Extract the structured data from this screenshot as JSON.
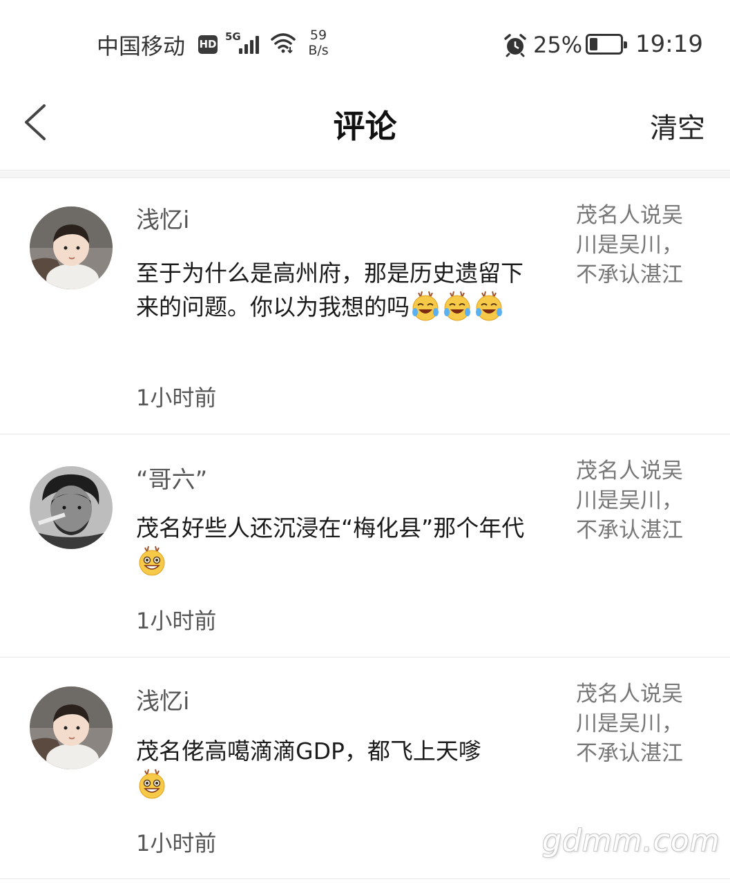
{
  "status_bar": {
    "carrier": "中国移动",
    "hd_badge": "HD",
    "network": "5G",
    "speed_value": "59",
    "speed_unit": "B/s",
    "battery_percent": "25%",
    "battery_level": 0.25,
    "time": "19:19",
    "icons": [
      "signal-icon",
      "wifi-icon",
      "alarm-icon",
      "battery-icon"
    ]
  },
  "header": {
    "title": "评论",
    "clear_label": "清空",
    "back_icon": "chevron-left-icon"
  },
  "comments": [
    {
      "username": "浅忆i",
      "text": "至于为什么是高州府，那是历史遗留下来的问题。你以为我想的吗",
      "trailing_emojis": [
        "laugh-cry-emoji",
        "laugh-cry-emoji",
        "laugh-cry-emoji"
      ],
      "time": "1小时前",
      "source_title": "茂名人说吴川是吴川，不承认湛江",
      "avatar": "toddler-avatar"
    },
    {
      "username": "“哥六”",
      "text": "茂名好些人还沉浸在“梅化县”那个年代",
      "trailing_emojis": [
        "grin-emoji"
      ],
      "time": "1小时前",
      "source_title": "茂名人说吴川是吴川，不承认湛江",
      "avatar": "portrait-avatar"
    },
    {
      "username": "浅忆i",
      "text": "茂名佬高噶滴滴GDP，都飞上天嗲",
      "trailing_emojis": [
        "grin-emoji"
      ],
      "time": "1小时前",
      "source_title": "茂名人说吴川是吴川，不承认湛江",
      "avatar": "toddler-avatar"
    }
  ],
  "watermark": "gdmm.com",
  "colors": {
    "background": "#ffffff",
    "divider": "#e6e6e6",
    "secondary_text": "#777777",
    "emoji_yellow": "#f7c948"
  }
}
